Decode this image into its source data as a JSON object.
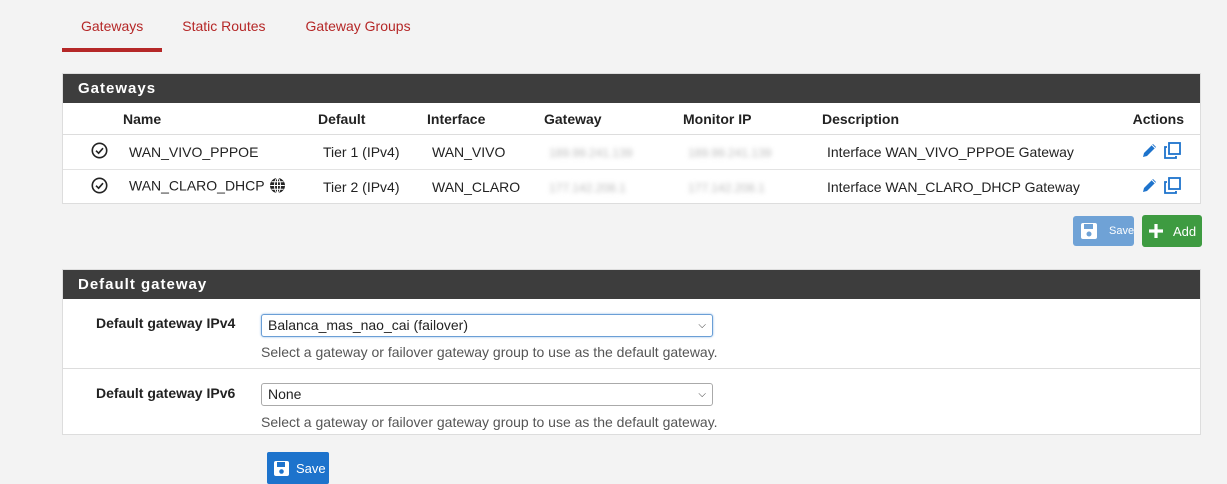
{
  "tabs": [
    {
      "label": "Gateways"
    },
    {
      "label": "Static Routes"
    },
    {
      "label": "Gateway Groups"
    }
  ],
  "gateways_panel": {
    "title": "Gateways",
    "columns": [
      "Name",
      "Default",
      "Interface",
      "Gateway",
      "Monitor IP",
      "Description",
      "Actions"
    ],
    "rows": [
      {
        "name": "WAN_VIVO_PPPOE",
        "default": "Tier 1 (IPv4)",
        "interface": "WAN_VIVO",
        "gateway": "189.99.241.139",
        "monitor_ip": "189.99.241.139",
        "description": "Interface WAN_VIVO_PPPOE Gateway"
      },
      {
        "name": "WAN_CLARO_DHCP",
        "default": "Tier 2 (IPv4)",
        "interface": "WAN_CLARO",
        "gateway": "177.142.208.1",
        "monitor_ip": "177.142.208.1",
        "description": "Interface WAN_CLARO_DHCP Gateway"
      }
    ],
    "save_label": "Save",
    "add_label": "Add"
  },
  "default_gateway_panel": {
    "title": "Default gateway",
    "ipv4": {
      "label": "Default gateway IPv4",
      "value": "Balanca_mas_nao_cai (failover)",
      "help": "Select a gateway or failover gateway group to use as the default gateway."
    },
    "ipv6": {
      "label": "Default gateway IPv6",
      "value": "None",
      "help": "Select a gateway or failover gateway group to use as the default gateway."
    }
  },
  "save_label": "Save",
  "colors": {
    "accent": "#b52727",
    "header": "#3d3d3d",
    "primary": "#1d73cc",
    "success": "#3e9b41",
    "icon": "#1d73cc"
  }
}
